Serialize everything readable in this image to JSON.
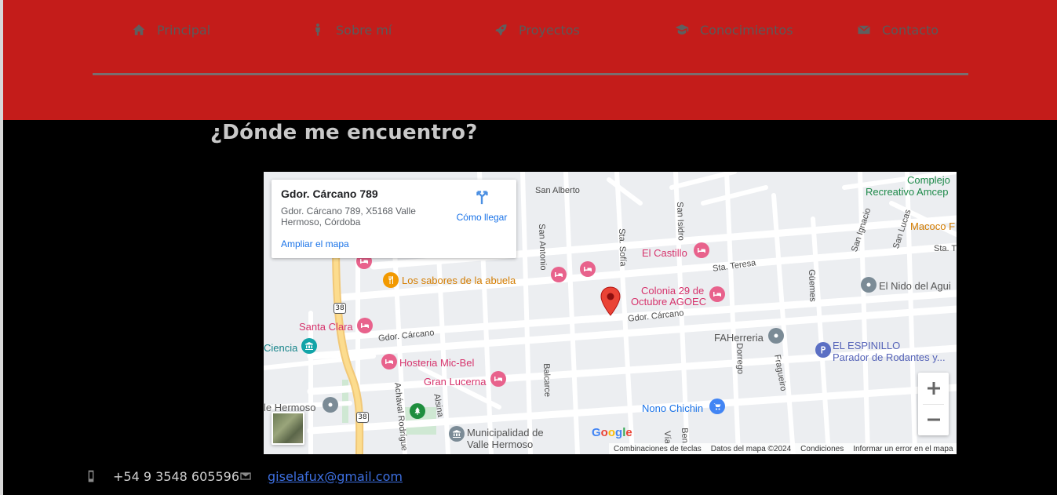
{
  "nav": {
    "items": [
      {
        "label": "Principal",
        "icon": "home-icon"
      },
      {
        "label": "Sobre mí",
        "icon": "person-icon"
      },
      {
        "label": "Proyectos",
        "icon": "rocket-icon"
      },
      {
        "label": "Conocimientos",
        "icon": "graduation-icon"
      },
      {
        "label": "Contacto",
        "icon": "envelope-icon"
      }
    ]
  },
  "section": {
    "title": "¿Dónde me encuentro?"
  },
  "map": {
    "info": {
      "title": "Gdor. Cárcano 789",
      "address": "Gdor. Cárcano 789, X5168 Valle Hermoso, Córdoba",
      "enlarge": "Ampliar el mapa",
      "directions": "Cómo llegar"
    },
    "labels": {
      "complejo": "Complejo",
      "recreativo": "Recreativo Amcep",
      "macoco": "Macoco F",
      "san_alberto": "San Alberto",
      "el_castillo": "El Castillo",
      "sta_teresa": "Sta. Teresa",
      "sta_teresa_2": "Sta. T",
      "los_sabores": "Los sabores de la abuela",
      "colonia_1": "Colonia 29 de",
      "colonia_2": "Octubre AGOEC",
      "el_nido": "El Nido del Agui",
      "gdor_carcano": "Gdor. Cárcano",
      "gdor_carcano_2": "Gdor. Cárcano",
      "santa_clara": "Santa Clara",
      "ciencia": "Ciencia",
      "faherreria": "FAHerreria",
      "el_espinillo_1": "EL ESPINILLO",
      "el_espinillo_2": "Parador de Rodantes y...",
      "hosteria": "Hosteria Mic-Bel",
      "gran_lucerna": "Gran Lucerna",
      "valle_hermoso": "le Hermoso",
      "nono_chichin": "Nono Chichin",
      "municipalidad_1": "Municipalidad de",
      "municipalidad_2": "Valle Hermoso",
      "san_antonio": "San Antonio",
      "sta_sofia": "Sta. Sofía",
      "san_isidro": "San Isidro",
      "san_ignacio": "San Ignacio",
      "san_lucas": "San Lucas",
      "guemes": "Güemes",
      "dorrego": "Dorrego",
      "fragueiro": "Fragueiro",
      "balcarce": "Balcarce",
      "alsina": "Alsina",
      "achaval": "Achával Rodrígue",
      "via": "Vía",
      "ben": "Ben...",
      "route_38": "38",
      "route_38_b": "38"
    },
    "google": "Google",
    "attribution": {
      "shortcuts": "Combinaciones de teclas",
      "data": "Datos del mapa ©2024",
      "terms": "Condiciones",
      "report": "Informar un error en el mapa"
    }
  },
  "footer": {
    "phone": "+54 9 3548 605596",
    "email": "giselafux@gmail.com"
  }
}
